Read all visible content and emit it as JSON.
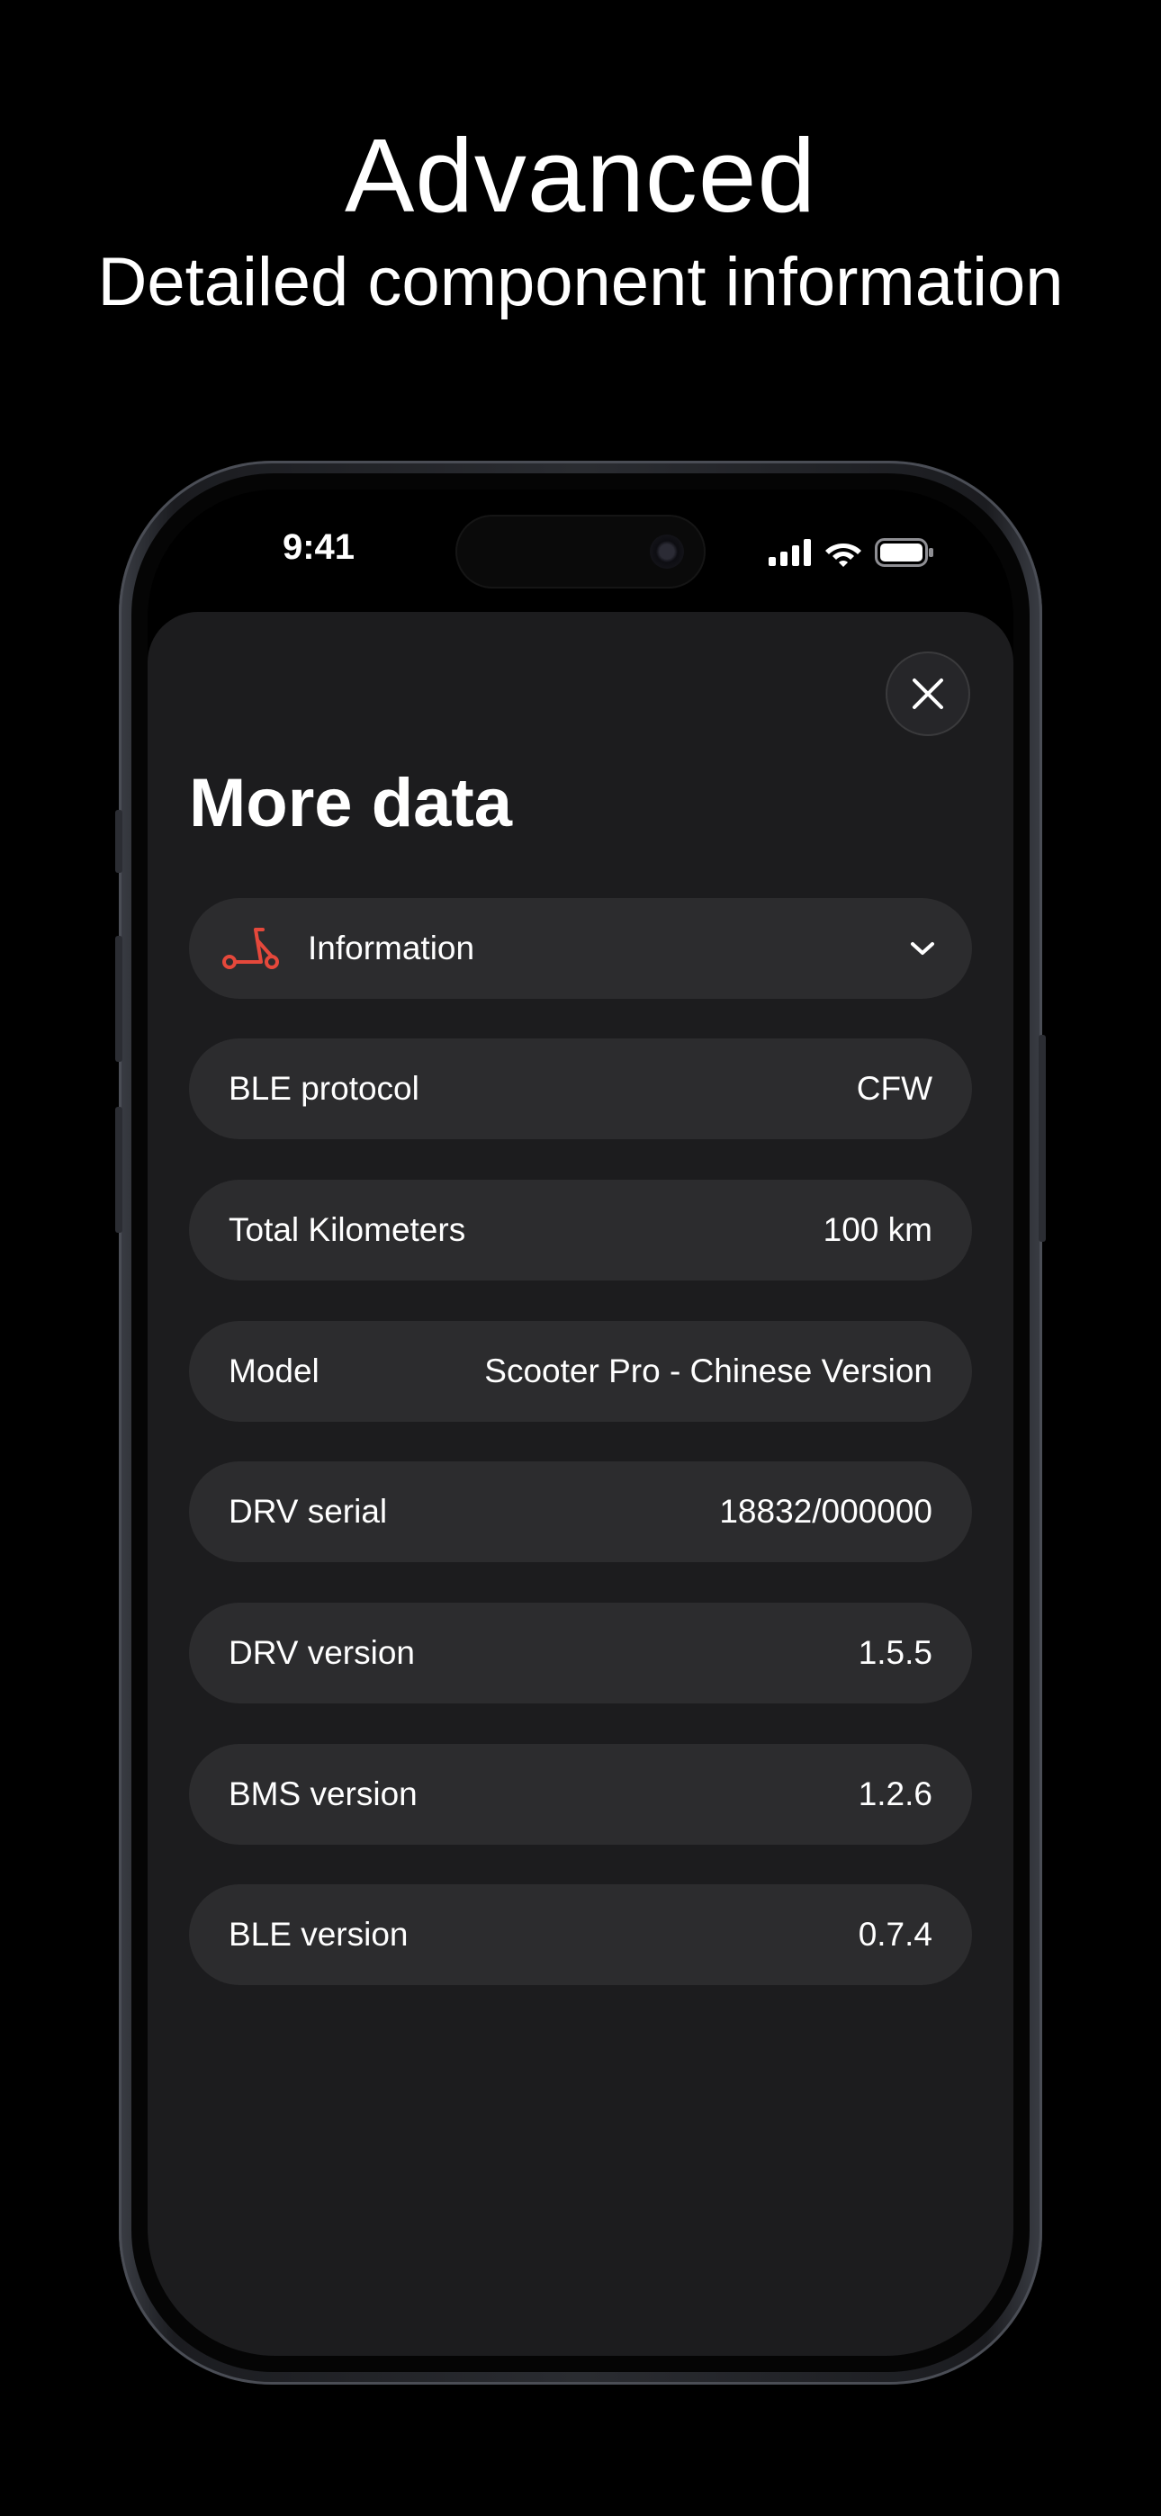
{
  "promo": {
    "headline": "Advanced",
    "subheadline": "Detailed component information"
  },
  "status_bar": {
    "time": "9:41",
    "icons": [
      "cellular-signal-icon",
      "wifi-icon",
      "battery-icon"
    ]
  },
  "sheet": {
    "title": "More data",
    "close_icon": "close-icon"
  },
  "selector": {
    "icon": "scooter-icon",
    "label": "Information",
    "chevron": "chevron-down-icon"
  },
  "rows": [
    {
      "label": "BLE protocol",
      "value": "CFW"
    },
    {
      "label": "Total Kilometers",
      "value": "100 km"
    },
    {
      "label": "Model",
      "value": "Scooter Pro - Chinese Version"
    },
    {
      "label": "DRV serial",
      "value": "18832/000000"
    },
    {
      "label": "DRV version",
      "value": "1.5.5"
    },
    {
      "label": "BMS version",
      "value": "1.2.6"
    },
    {
      "label": "BLE version",
      "value": "0.7.4"
    }
  ],
  "colors": {
    "background": "#000000",
    "sheet": "#1c1c1e",
    "row": "#2c2c2e",
    "accent": "#e5483b"
  }
}
